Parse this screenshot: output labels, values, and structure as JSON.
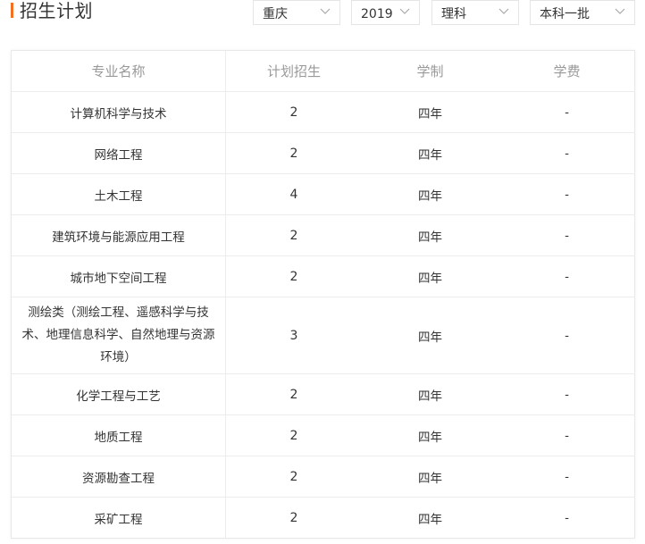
{
  "header": {
    "title": "招生计划"
  },
  "filters": {
    "province": "重庆",
    "year": "2019",
    "subject": "理科",
    "batch": "本科一批"
  },
  "colors": {
    "accent": "#f36f21",
    "border": "#ececec",
    "header_text": "#999999"
  },
  "table": {
    "columns": [
      "专业名称",
      "计划招生",
      "学制",
      "学费"
    ],
    "rows": [
      {
        "name": "计算机科学与技术",
        "plan": "2",
        "years": "四年",
        "fee": "-"
      },
      {
        "name": "网络工程",
        "plan": "2",
        "years": "四年",
        "fee": "-"
      },
      {
        "name": "土木工程",
        "plan": "4",
        "years": "四年",
        "fee": "-"
      },
      {
        "name": "建筑环境与能源应用工程",
        "plan": "2",
        "years": "四年",
        "fee": "-"
      },
      {
        "name": "城市地下空间工程",
        "plan": "2",
        "years": "四年",
        "fee": "-"
      },
      {
        "name": "测绘类（测绘工程、遥感科学与技术、地理信息科学、自然地理与资源环境）",
        "plan": "3",
        "years": "四年",
        "fee": "-"
      },
      {
        "name": "化学工程与工艺",
        "plan": "2",
        "years": "四年",
        "fee": "-"
      },
      {
        "name": "地质工程",
        "plan": "2",
        "years": "四年",
        "fee": "-"
      },
      {
        "name": "资源勘查工程",
        "plan": "2",
        "years": "四年",
        "fee": "-"
      },
      {
        "name": "采矿工程",
        "plan": "2",
        "years": "四年",
        "fee": "-"
      }
    ]
  }
}
